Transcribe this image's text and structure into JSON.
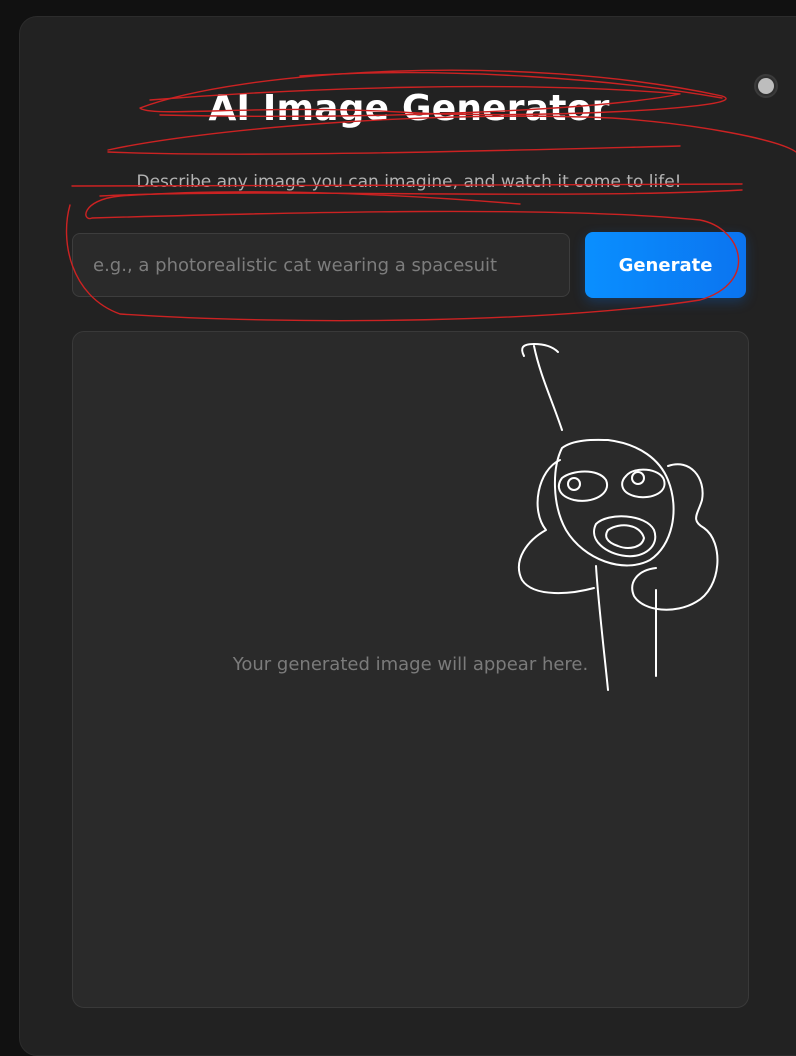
{
  "app": {
    "title": "AI Image Generator",
    "subtitle": "Describe any image you can imagine, and watch it come to life!"
  },
  "theme_toggle": {
    "icon": "sun-icon"
  },
  "prompt": {
    "value": "",
    "placeholder": "e.g., a photorealistic cat wearing a spacesuit"
  },
  "generate_button": {
    "label": "Generate"
  },
  "output": {
    "placeholder": "Your generated image will appear here."
  },
  "colors": {
    "accent": "#0a8fff",
    "background": "#111111",
    "card": "#222222",
    "annotation_red": "#cc2222",
    "annotation_white": "#ffffff"
  }
}
